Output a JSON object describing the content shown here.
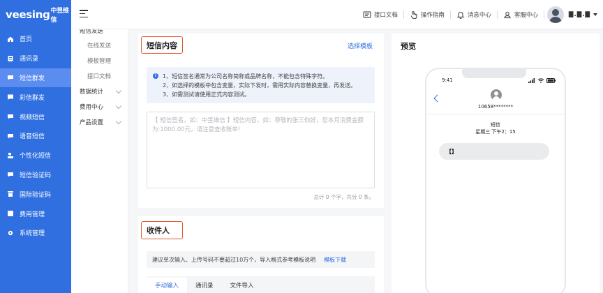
{
  "brand": {
    "logo": "veesing",
    "logo_sub": "中昱维信"
  },
  "sidebar": {
    "items": [
      {
        "label": "首页",
        "icon": "home-icon"
      },
      {
        "label": "通讯录",
        "icon": "contacts-icon"
      },
      {
        "label": "短信群发",
        "icon": "sms-icon",
        "active": true
      },
      {
        "label": "彩信群发",
        "icon": "mms-icon"
      },
      {
        "label": "视频短信",
        "icon": "video-sms-icon"
      },
      {
        "label": "语音短信",
        "icon": "voice-sms-icon"
      },
      {
        "label": "个性化短信",
        "icon": "personalized-sms-icon"
      },
      {
        "label": "短信验证码",
        "icon": "sms-code-icon"
      },
      {
        "label": "国际验证码",
        "icon": "intl-code-icon"
      },
      {
        "label": "费用管理",
        "icon": "billing-icon"
      },
      {
        "label": "系统管理",
        "icon": "settings-icon"
      }
    ]
  },
  "subnav": {
    "header": "短信发送",
    "links": [
      "在线发送",
      "模板管理",
      "接口文档"
    ],
    "groups": [
      "数据统计",
      "费用中心",
      "产品设置"
    ]
  },
  "topbar": {
    "items": [
      {
        "label": "接口文档",
        "icon": "api-doc-icon"
      },
      {
        "label": "操作指南",
        "icon": "guide-icon"
      },
      {
        "label": "消息中心",
        "icon": "bell-icon"
      },
      {
        "label": "客服中心",
        "icon": "support-icon"
      }
    ],
    "username": "▇.▇.▇"
  },
  "content": {
    "title": "短信内容",
    "select_template": "选择模板",
    "tips": [
      "1、短信签名通常为公司名称简称或品牌名称，不能包含特殊字符。",
      "2、如选择的模板中包含变量，实际下发时，需用实际内容替换变量，再发送。",
      "3、如需测试请使用正式内容测试。"
    ],
    "placeholder": "【 短信签名，如：中昱维信 】短信内容，如：尊敬的张三你好，您本月消费金额为:1000.00元，请注意查收账单!",
    "counter": "总计 0 个字，共分 0 条。"
  },
  "recipient": {
    "title": "收件人",
    "notice": "建议单次输入、上传号码不要超过10万个，导入格式参考模板说明",
    "template_download": "模板下载",
    "tabs": [
      "手动输入",
      "通讯录",
      "文件导入"
    ]
  },
  "preview": {
    "title": "预览",
    "time": "9:41",
    "number": "10658********",
    "kind": "短信",
    "datetime": "星期三  下午2：15",
    "bubble": "【】"
  },
  "colors": {
    "primary": "#2f6fe0",
    "highlight": "#e8582b"
  }
}
